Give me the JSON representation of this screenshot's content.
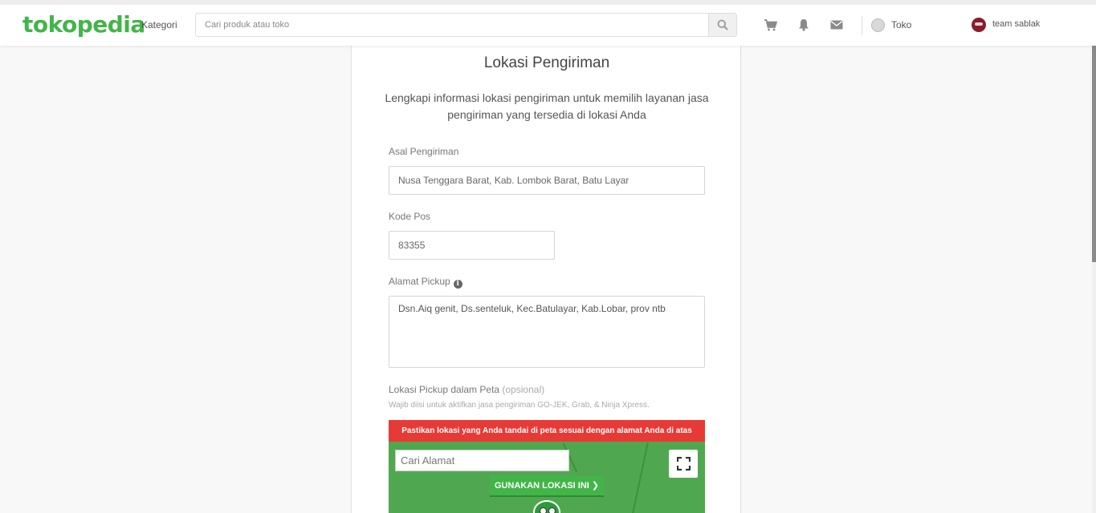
{
  "header": {
    "logo": "tokopedia",
    "kategori": "Kategori",
    "search_placeholder": "Cari produk atau toko",
    "toko_label": "Toko",
    "user_label": "team sablak"
  },
  "form": {
    "title": "Lokasi Pengiriman",
    "description": "Lengkapi informasi lokasi pengiriman untuk memilih layanan jasa pengiriman yang tersedia di lokasi Anda",
    "origin_label": "Asal Pengiriman",
    "origin_value": "Nusa Tenggara Barat, Kab. Lombok Barat, Batu Layar",
    "postal_label": "Kode Pos",
    "postal_value": "83355",
    "pickup_label": "Alamat Pickup",
    "pickup_value": "Dsn.Aiq genit, Ds.senteluk, Kec.Batulayar, Kab.Lobar, prov ntb",
    "map_label": "Lokasi Pickup dalam Peta",
    "map_optional": "(opsional)",
    "map_hint": "Wajib diisi untuk aktifkan jasa pengiriman GO-JEK, Grab, & Ninja Xpress."
  },
  "map": {
    "banner": "Pastikan lokasi yang Anda tandai di peta sesuai dengan alamat Anda di atas",
    "search_placeholder": "Cari Alamat",
    "use_location_button": "GUNAKAN LOKASI INI"
  },
  "colors": {
    "brand": "#42b549",
    "banner": "#e73a36",
    "map": "#4fa84f"
  }
}
